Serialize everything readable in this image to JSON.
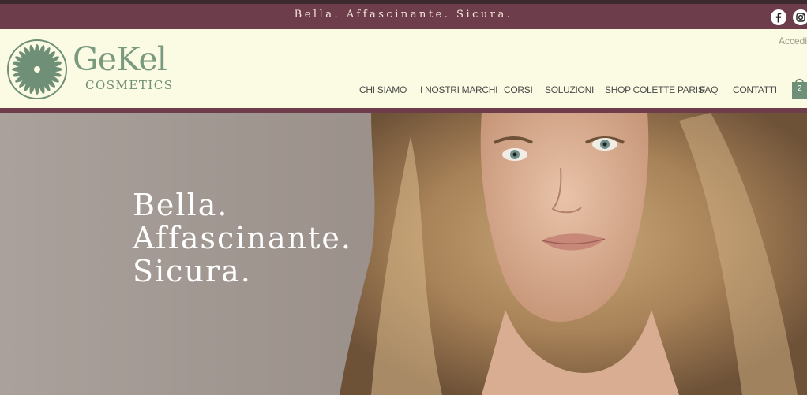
{
  "banner": {
    "tagline": "Bella. Affascinante. Sicura."
  },
  "social": [
    {
      "icon": "facebook-icon"
    },
    {
      "icon": "instagram-icon"
    }
  ],
  "brand": {
    "name": "GeKel",
    "subtitle": "COSMETICS"
  },
  "header": {
    "login_label": "Accedi"
  },
  "nav": {
    "items": [
      {
        "label": "CHI SIAMO"
      },
      {
        "label": "I NOSTRI MARCHI"
      },
      {
        "label": "CORSI"
      },
      {
        "label": "SOLUZIONI"
      },
      {
        "label": "SHOP COLETTE PARIS"
      },
      {
        "label": "FAQ"
      },
      {
        "label": "CONTATTI"
      }
    ]
  },
  "cart": {
    "count": "2",
    "icon": "shopping-bag-icon"
  },
  "hero": {
    "line1": "Bella.",
    "line2": "Affascinante.",
    "line3": "Sicura."
  },
  "colors": {
    "burgundy": "#6e3d4b",
    "cream": "#fbfbe3",
    "sage": "#7a9a80"
  }
}
